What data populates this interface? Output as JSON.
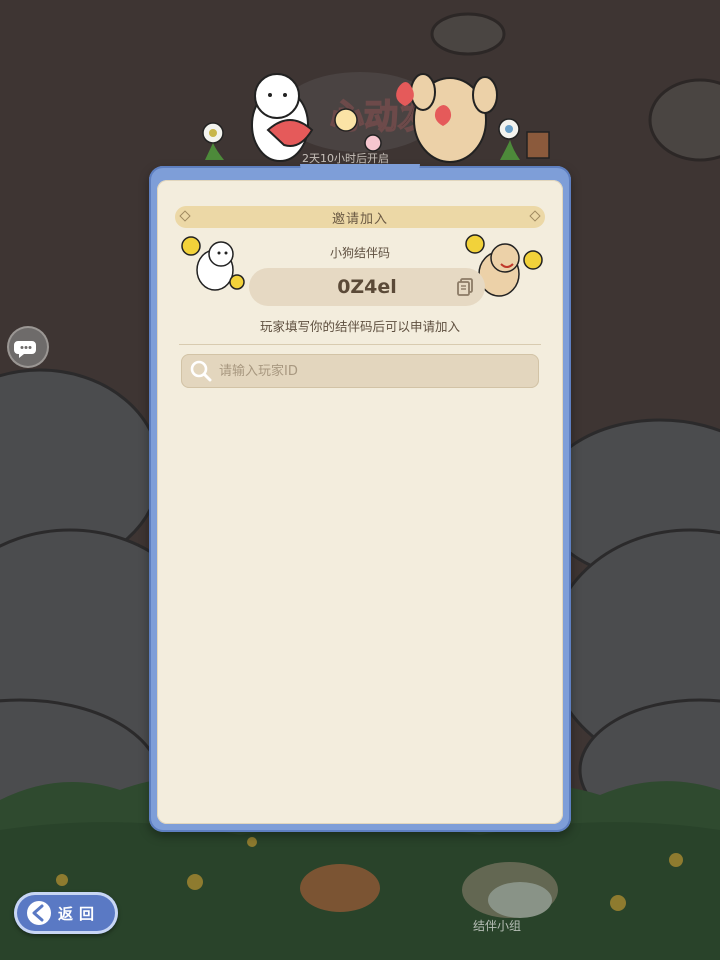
{
  "event": {
    "title_text": "心动发",
    "countdown_text": "2天10小时后开启"
  },
  "modal": {
    "title": "邀请加入",
    "code_label": "小狗结伴码",
    "code_value": "0Z4el",
    "hint": "玩家填写你的结伴码后可以申请加入",
    "search": {
      "placeholder": "请输入玩家ID",
      "value": ""
    }
  },
  "back_button": {
    "label": "返回"
  },
  "bottom": {
    "label": "结伴小组"
  },
  "icons": {
    "side": "chat-bubble-icon",
    "copy": "copy-icon",
    "search": "search-icon",
    "back": "back-arrow-icon"
  },
  "colors": {
    "background": "#3e3533",
    "modal_frame": "#7e9ed8",
    "modal_body": "#f3eddd",
    "title_bar": "#ecd8a6",
    "code_box": "#e6d9c3",
    "back_button": "#5a79c4"
  }
}
